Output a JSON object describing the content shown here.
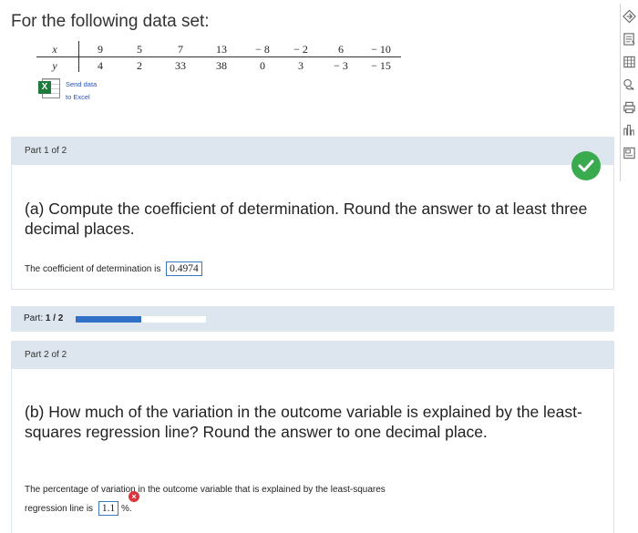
{
  "heading": "For the following data set:",
  "table": {
    "x_label": "x",
    "y_label": "y",
    "x_values": [
      "9",
      "5",
      "7",
      "13",
      "− 8",
      "− 2",
      "6",
      "− 10"
    ],
    "y_values": [
      "4",
      "2",
      "33",
      "38",
      "0",
      "3",
      "− 3",
      "− 15"
    ]
  },
  "excel_link": {
    "line1": "Send data",
    "line2": "to Excel",
    "icon": "excel-icon"
  },
  "part1": {
    "header": "Part 1 of 2",
    "question": "(a) Compute the coefficient of determination. Round the answer to at least three decimal places.",
    "answer_prefix": "The coefficient of determination is",
    "answer_value": "0.4974",
    "status_icon": "check-icon",
    "status_color": "#3aaa4f"
  },
  "progress": {
    "label_prefix": "Part:",
    "label_value": "1 / 2",
    "fraction": 0.5,
    "bar_color": "#3170c7"
  },
  "part2": {
    "header": "Part 2 of 2",
    "question": "(b) How much of the variation in the outcome variable is explained by the least-squares regression line? Round the answer to one decimal place.",
    "answer_line1": "The percentage of variation in the outcome variable that is explained by the least-squares",
    "answer_line2_prefix": "regression line is",
    "answer_value": "1.1",
    "answer_suffix": "%.",
    "error_icon": "error-x-icon",
    "error_color": "#d9363e"
  },
  "toolbar": [
    "tools-icon",
    "calculator-icon",
    "grid-icon",
    "hint-icon",
    "print-icon",
    "chart-icon",
    "data-icon"
  ]
}
